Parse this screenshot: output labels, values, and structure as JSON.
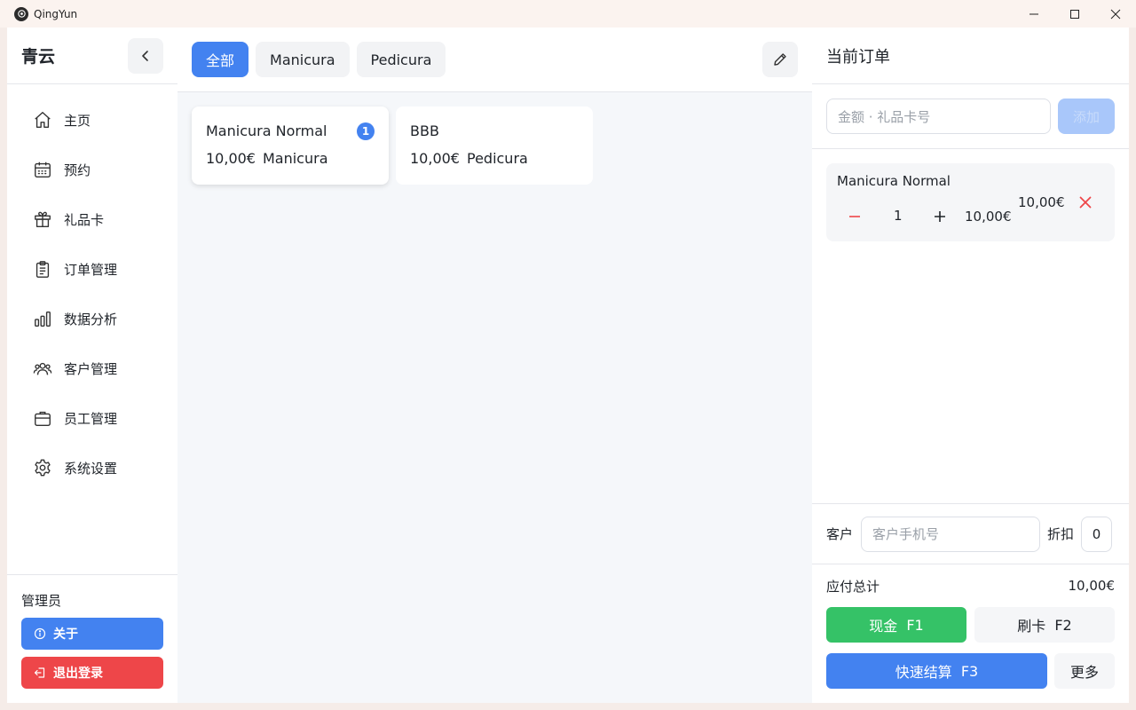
{
  "window": {
    "title": "QingYun"
  },
  "sidebar": {
    "brand": "青云",
    "items": [
      {
        "label": "主页",
        "icon": "home-icon"
      },
      {
        "label": "预约",
        "icon": "calendar-icon"
      },
      {
        "label": "礼品卡",
        "icon": "gift-icon"
      },
      {
        "label": "订单管理",
        "icon": "clipboard-icon"
      },
      {
        "label": "数据分析",
        "icon": "bar-chart-icon"
      },
      {
        "label": "客户管理",
        "icon": "users-icon"
      },
      {
        "label": "员工管理",
        "icon": "briefcase-icon"
      },
      {
        "label": "系统设置",
        "icon": "gear-icon"
      }
    ],
    "role": "管理员",
    "about_label": "关于",
    "logout_label": "退出登录"
  },
  "tabs": [
    {
      "label": "全部",
      "active": true
    },
    {
      "label": "Manicura",
      "active": false
    },
    {
      "label": "Pedicura",
      "active": false
    }
  ],
  "products": [
    {
      "name": "Manicura Normal",
      "price": "10,00€",
      "category": "Manicura",
      "count": "1"
    },
    {
      "name": "BBB",
      "price": "10,00€",
      "category": "Pedicura"
    }
  ],
  "order": {
    "title": "当前订单",
    "gift_placeholder": "金额 · 礼品卡号",
    "add_label": "添加",
    "items": [
      {
        "name": "Manicura Normal",
        "qty": "1",
        "unit_price": "10,00€",
        "total": "10,00€"
      }
    ],
    "customer_label": "客户",
    "customer_placeholder": "客户手机号",
    "discount_label": "折扣",
    "discount_value": "0",
    "total_label": "应付总计",
    "total_value": "10,00€",
    "cash": {
      "label": "现金",
      "key": "F1"
    },
    "card": {
      "label": "刷卡",
      "key": "F2"
    },
    "quick": {
      "label": "快速结算",
      "key": "F3"
    },
    "more_label": "更多"
  },
  "colors": {
    "accent": "#4382f0",
    "success": "#35c267",
    "danger": "#ee4649",
    "disabled_accent": "#a9c7fa"
  }
}
